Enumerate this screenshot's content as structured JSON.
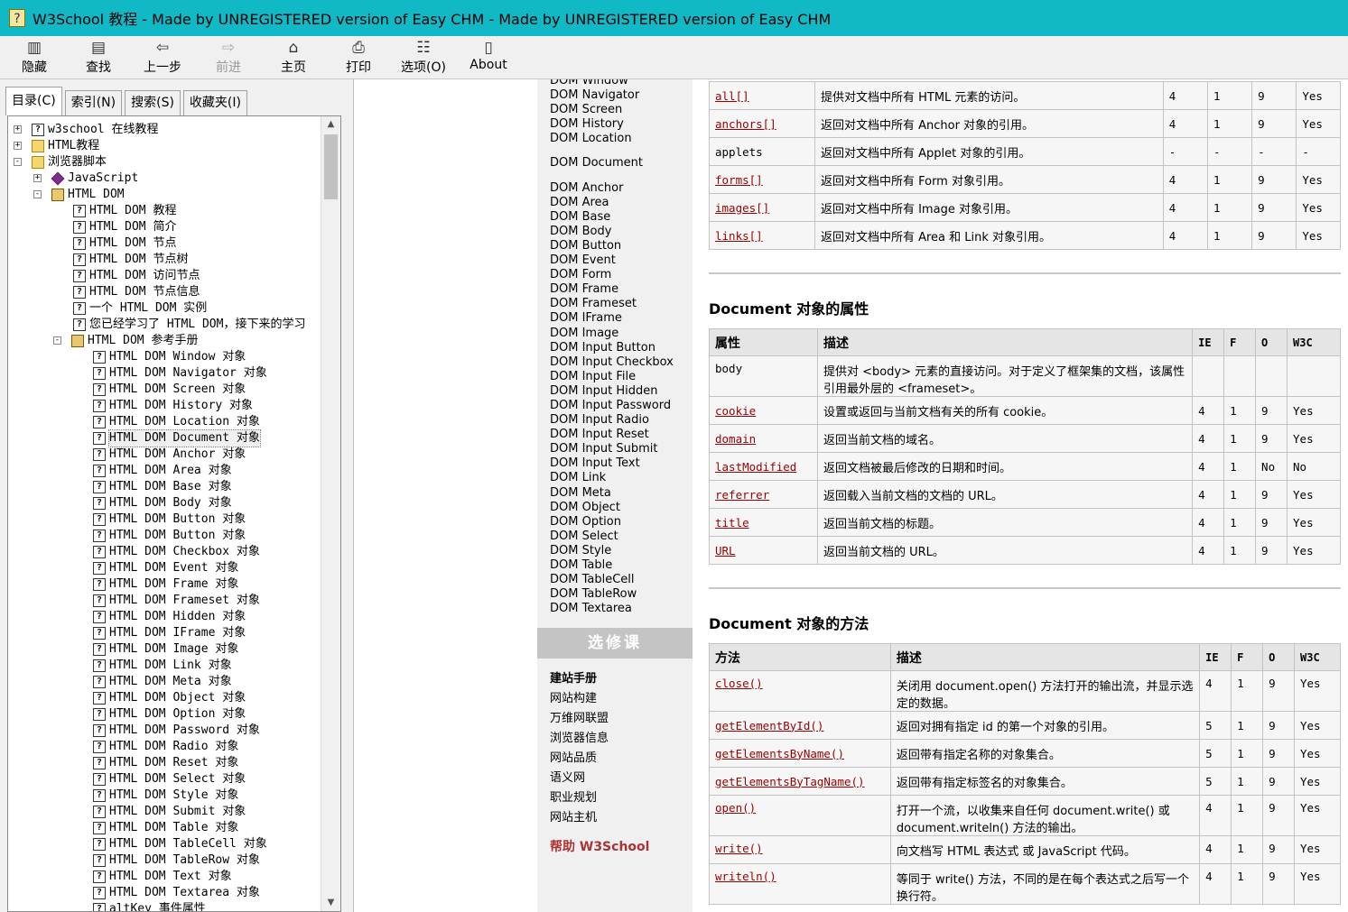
{
  "window": {
    "title": "W3School 教程 - Made by UNREGISTERED version of Easy CHM - Made by UNREGISTERED version of Easy CHM"
  },
  "toolbar": {
    "hide": "隐藏",
    "find": "查找",
    "back": "上一步",
    "forward": "前进",
    "home": "主页",
    "print": "打印",
    "options": "选项(O)",
    "about": "About"
  },
  "tabs": {
    "contents": "目录(C)",
    "index": "索引(N)",
    "search": "搜索(S)",
    "favorites": "收藏夹(I)"
  },
  "tree": [
    {
      "label": "w3school 在线教程",
      "depth": 0,
      "expander": "+",
      "icon": "page"
    },
    {
      "label": "HTML教程",
      "depth": 0,
      "expander": "+",
      "icon": "folder"
    },
    {
      "label": "浏览器脚本",
      "depth": 0,
      "expander": "-",
      "icon": "folder"
    },
    {
      "label": "JavaScript",
      "depth": 1,
      "expander": "+",
      "icon": "gem"
    },
    {
      "label": "HTML DOM",
      "depth": 1,
      "expander": "-",
      "icon": "book"
    },
    {
      "label": "HTML DOM 教程",
      "depth": 2,
      "icon": "page"
    },
    {
      "label": "HTML DOM 简介",
      "depth": 2,
      "icon": "page"
    },
    {
      "label": "HTML DOM 节点",
      "depth": 2,
      "icon": "page"
    },
    {
      "label": "HTML DOM 节点树",
      "depth": 2,
      "icon": "page"
    },
    {
      "label": "HTML DOM 访问节点",
      "depth": 2,
      "icon": "page"
    },
    {
      "label": "HTML DOM 节点信息",
      "depth": 2,
      "icon": "page"
    },
    {
      "label": "一个 HTML DOM 实例",
      "depth": 2,
      "icon": "page"
    },
    {
      "label": "您已经学习了 HTML DOM，接下来的学习",
      "depth": 2,
      "icon": "page"
    },
    {
      "label": "HTML DOM 参考手册",
      "depth": 2,
      "expander": "-",
      "icon": "book"
    },
    {
      "label": "HTML DOM Window 对象",
      "depth": 3,
      "icon": "page"
    },
    {
      "label": "HTML DOM Navigator 对象",
      "depth": 3,
      "icon": "page"
    },
    {
      "label": "HTML DOM Screen 对象",
      "depth": 3,
      "icon": "page"
    },
    {
      "label": "HTML DOM History 对象",
      "depth": 3,
      "icon": "page"
    },
    {
      "label": "HTML DOM Location 对象",
      "depth": 3,
      "icon": "page"
    },
    {
      "label": "HTML DOM Document 对象",
      "depth": 3,
      "icon": "page",
      "selected": true
    },
    {
      "label": "HTML DOM Anchor 对象",
      "depth": 3,
      "icon": "page"
    },
    {
      "label": "HTML DOM Area 对象",
      "depth": 3,
      "icon": "page"
    },
    {
      "label": "HTML DOM Base 对象",
      "depth": 3,
      "icon": "page"
    },
    {
      "label": "HTML DOM Body 对象",
      "depth": 3,
      "icon": "page"
    },
    {
      "label": "HTML DOM Button 对象",
      "depth": 3,
      "icon": "page"
    },
    {
      "label": "HTML DOM Button 对象",
      "depth": 3,
      "icon": "page"
    },
    {
      "label": "HTML DOM Checkbox 对象",
      "depth": 3,
      "icon": "page"
    },
    {
      "label": "HTML DOM Event 对象",
      "depth": 3,
      "icon": "page"
    },
    {
      "label": "HTML DOM Frame 对象",
      "depth": 3,
      "icon": "page"
    },
    {
      "label": "HTML DOM Frameset 对象",
      "depth": 3,
      "icon": "page"
    },
    {
      "label": "HTML DOM Hidden 对象",
      "depth": 3,
      "icon": "page"
    },
    {
      "label": "HTML DOM IFrame 对象",
      "depth": 3,
      "icon": "page"
    },
    {
      "label": "HTML DOM Image 对象",
      "depth": 3,
      "icon": "page"
    },
    {
      "label": "HTML DOM Link 对象",
      "depth": 3,
      "icon": "page"
    },
    {
      "label": "HTML DOM Meta 对象",
      "depth": 3,
      "icon": "page"
    },
    {
      "label": "HTML DOM Object 对象",
      "depth": 3,
      "icon": "page"
    },
    {
      "label": "HTML DOM Option 对象",
      "depth": 3,
      "icon": "page"
    },
    {
      "label": "HTML DOM Password 对象",
      "depth": 3,
      "icon": "page"
    },
    {
      "label": "HTML DOM Radio 对象",
      "depth": 3,
      "icon": "page"
    },
    {
      "label": "HTML DOM Reset 对象",
      "depth": 3,
      "icon": "page"
    },
    {
      "label": "HTML DOM Select 对象",
      "depth": 3,
      "icon": "page"
    },
    {
      "label": "HTML DOM Style 对象",
      "depth": 3,
      "icon": "page"
    },
    {
      "label": "HTML DOM Submit 对象",
      "depth": 3,
      "icon": "page"
    },
    {
      "label": "HTML DOM Table 对象",
      "depth": 3,
      "icon": "page"
    },
    {
      "label": "HTML DOM TableCell 对象",
      "depth": 3,
      "icon": "page"
    },
    {
      "label": "HTML DOM TableRow 对象",
      "depth": 3,
      "icon": "page"
    },
    {
      "label": "HTML DOM Text 对象",
      "depth": 3,
      "icon": "page"
    },
    {
      "label": "HTML DOM Textarea 对象",
      "depth": 3,
      "icon": "page"
    },
    {
      "label": "altKey 事件属性",
      "depth": 3,
      "icon": "page"
    }
  ],
  "dom_nav": [
    "DOM Window",
    "DOM Navigator",
    "DOM Screen",
    "DOM History",
    "DOM Location",
    "DOM Document",
    "DOM Anchor",
    "DOM Area",
    "DOM Base",
    "DOM Body",
    "DOM Button",
    "DOM Event",
    "DOM Form",
    "DOM Frame",
    "DOM Frameset",
    "DOM IFrame",
    "DOM Image",
    "DOM Input Button",
    "DOM Input Checkbox",
    "DOM Input File",
    "DOM Input Hidden",
    "DOM Input Password",
    "DOM Input Radio",
    "DOM Input Reset",
    "DOM Input Submit",
    "DOM Input Text",
    "DOM Link",
    "DOM Meta",
    "DOM Object",
    "DOM Option",
    "DOM Select",
    "DOM Style",
    "DOM Table",
    "DOM TableCell",
    "DOM TableRow",
    "DOM Textarea"
  ],
  "electives": {
    "heading": "选修课",
    "items": [
      "建站手册",
      "网站构建",
      "万维网联盟",
      "浏览器信息",
      "网站品质",
      "语义网",
      "职业规划",
      "网站主机"
    ],
    "help": "帮助 W3School"
  },
  "collections_table": [
    [
      "all[]",
      "提供对文档中所有 HTML 元素的访问。",
      "4",
      "1",
      "9",
      "Yes"
    ],
    [
      "anchors[]",
      "返回对文档中所有 Anchor 对象的引用。",
      "4",
      "1",
      "9",
      "Yes"
    ],
    [
      "applets",
      "返回对文档中所有 Applet 对象的引用。",
      "-",
      "-",
      "-",
      "-"
    ],
    [
      "forms[]",
      "返回对文档中所有 Form 对象引用。",
      "4",
      "1",
      "9",
      "Yes"
    ],
    [
      "images[]",
      "返回对文档中所有 Image 对象引用。",
      "4",
      "1",
      "9",
      "Yes"
    ],
    [
      "links[]",
      "返回对文档中所有 Area 和 Link 对象引用。",
      "4",
      "1",
      "9",
      "Yes"
    ]
  ],
  "properties": {
    "heading": "Document 对象的属性",
    "headers": [
      "属性",
      "描述",
      "IE",
      "F",
      "O",
      "W3C"
    ],
    "rows": [
      [
        "body",
        "提供对 <body> 元素的直接访问。对于定义了框架集的文档，该属性引用最外层的 <frameset>。",
        "",
        "",
        "",
        ""
      ],
      [
        "cookie",
        "设置或返回与当前文档有关的所有 cookie。",
        "4",
        "1",
        "9",
        "Yes"
      ],
      [
        "domain",
        "返回当前文档的域名。",
        "4",
        "1",
        "9",
        "Yes"
      ],
      [
        "lastModified",
        "返回文档被最后修改的日期和时间。",
        "4",
        "1",
        "No",
        "No"
      ],
      [
        "referrer",
        "返回载入当前文档的文档的 URL。",
        "4",
        "1",
        "9",
        "Yes"
      ],
      [
        "title",
        "返回当前文档的标题。",
        "4",
        "1",
        "9",
        "Yes"
      ],
      [
        "URL",
        "返回当前文档的 URL。",
        "4",
        "1",
        "9",
        "Yes"
      ]
    ]
  },
  "methods": {
    "heading": "Document 对象的方法",
    "headers": [
      "方法",
      "描述",
      "IE",
      "F",
      "O",
      "W3C"
    ],
    "rows": [
      [
        "close()",
        "关闭用 document.open() 方法打开的输出流，并显示选定的数据。",
        "4",
        "1",
        "9",
        "Yes"
      ],
      [
        "getElementById()",
        "返回对拥有指定 id 的第一个对象的引用。",
        "5",
        "1",
        "9",
        "Yes"
      ],
      [
        "getElementsByName()",
        "返回带有指定名称的对象集合。",
        "5",
        "1",
        "9",
        "Yes"
      ],
      [
        "getElementsByTagName()",
        "返回带有指定标签名的对象集合。",
        "5",
        "1",
        "9",
        "Yes"
      ],
      [
        "open()",
        "打开一个流，以收集来自任何 document.write() 或 document.writeln() 方法的输出。",
        "4",
        "1",
        "9",
        "Yes"
      ],
      [
        "write()",
        "向文档写 HTML 表达式 或 JavaScript 代码。",
        "4",
        "1",
        "9",
        "Yes"
      ],
      [
        "writeln()",
        "等同于 write() 方法，不同的是在每个表达式之后写一个换行符。",
        "4",
        "1",
        "9",
        "Yes"
      ]
    ]
  }
}
